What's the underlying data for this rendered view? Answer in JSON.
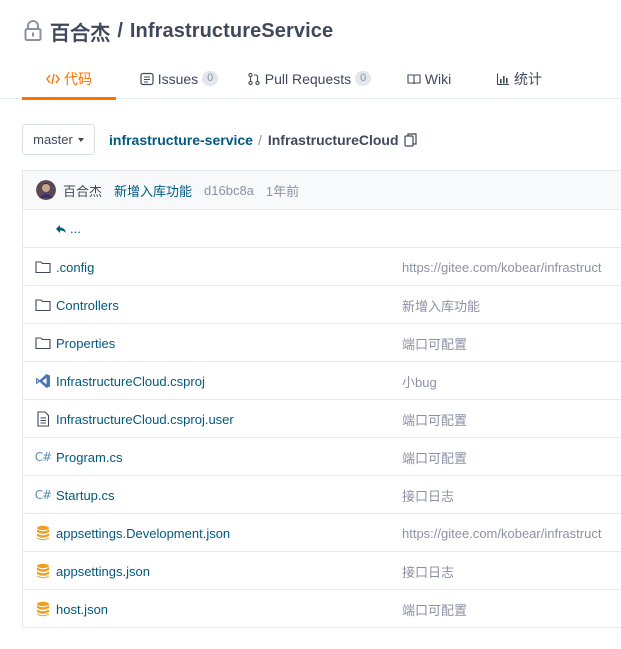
{
  "repo": {
    "owner": "百合杰",
    "separator": "/",
    "name": "InfrastructureService"
  },
  "tabs": [
    {
      "label": "代码",
      "icon": "code-icon",
      "active": true
    },
    {
      "label": "Issues",
      "icon": "issues-icon",
      "count": "0"
    },
    {
      "label": "Pull Requests",
      "icon": "pull-request-icon",
      "count": "0"
    },
    {
      "label": "Wiki",
      "icon": "wiki-icon"
    },
    {
      "label": "统计",
      "icon": "stats-icon"
    }
  ],
  "branch": {
    "name": "master"
  },
  "breadcrumb": {
    "root": "infrastructure-service",
    "separator": "/",
    "current": "InfrastructureCloud"
  },
  "commit": {
    "author": "百合杰",
    "message": "新增入库功能",
    "sha": "d16bc8a",
    "time": "1年前"
  },
  "parent_dir": "...",
  "files": [
    {
      "name": ".config",
      "type": "folder",
      "message": "https://gitee.com/kobear/infrastruct"
    },
    {
      "name": "Controllers",
      "type": "folder",
      "message": "新增入库功能"
    },
    {
      "name": "Properties",
      "type": "folder",
      "message": "端口可配置"
    },
    {
      "name": "InfrastructureCloud.csproj",
      "type": "vs-project",
      "message": "小bug"
    },
    {
      "name": "InfrastructureCloud.csproj.user",
      "type": "text-file",
      "message": "端口可配置"
    },
    {
      "name": "Program.cs",
      "type": "csharp",
      "message": "端口可配置"
    },
    {
      "name": "Startup.cs",
      "type": "csharp",
      "message": "接口日志"
    },
    {
      "name": "appsettings.Development.json",
      "type": "json-db",
      "message": "https://gitee.com/kobear/infrastruct"
    },
    {
      "name": "appsettings.json",
      "type": "json-db",
      "message": "接口日志"
    },
    {
      "name": "host.json",
      "type": "json-db",
      "message": "端口可配置"
    }
  ],
  "colors": {
    "accent": "#fe7300",
    "link": "#005980",
    "muted": "#8c92a4",
    "text": "#40485b",
    "json_icon": "#f0a020",
    "vs_icon": "#4a76b8"
  }
}
